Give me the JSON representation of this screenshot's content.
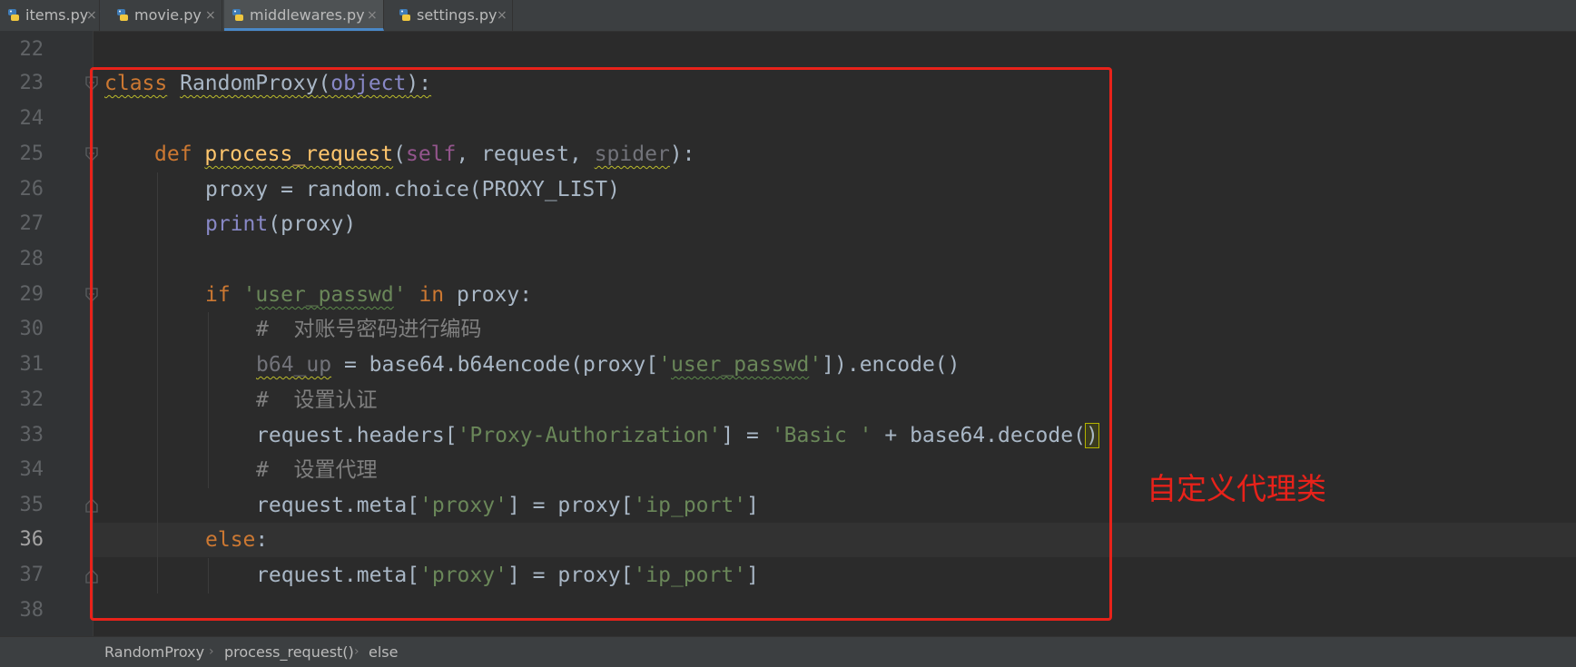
{
  "tabs": [
    {
      "label": "items.py",
      "close": "×",
      "icon": "python-file-icon"
    },
    {
      "label": "movie.py",
      "close": "×",
      "icon": "python-file-icon"
    },
    {
      "label": "middlewares.py",
      "close": "×",
      "icon": "python-file-icon",
      "active": true
    },
    {
      "label": "settings.py",
      "close": "×",
      "icon": "python-file-icon"
    }
  ],
  "editor": {
    "line_numbers": [
      "22",
      "23",
      "24",
      "25",
      "26",
      "27",
      "28",
      "29",
      "30",
      "31",
      "32",
      "33",
      "34",
      "35",
      "36",
      "37",
      "38"
    ],
    "current_line": "36",
    "code": {
      "l23_class": "class",
      "l23_name": "RandomProxy",
      "l23_p1": "(",
      "l23_object": "object",
      "l23_p2": "):",
      "l25_def": "def",
      "l25_fn": "process_request",
      "l25_p1": "(",
      "l25_self": "self",
      "l25_rest": ", request, ",
      "l25_spider": "spider",
      "l25_p2": "):",
      "l26": "proxy = random.choice(PROXY_LIST)",
      "l27_print": "print",
      "l27_rest": "(proxy)",
      "l29_if": "if",
      "l29_sp": " ",
      "l29_q1": "'",
      "l29_str": "user_passwd",
      "l29_q2": "'",
      "l29_in": " in",
      "l29_rest": " proxy:",
      "l30": "#  对账号密码进行编码",
      "l31_var": "b64_up",
      "l31_mid": " = base64.b64encode(proxy[",
      "l31_q1": "'",
      "l31_str": "user_passwd",
      "l31_q2": "'",
      "l31_end": "]).encode()",
      "l32": "#  设置认证",
      "l33_a": "request.headers[",
      "l33_str1": "'Proxy-Authorization'",
      "l33_b": "] = ",
      "l33_str2": "'Basic '",
      "l33_c": " + base64.decode(",
      "l33_d": ")",
      "l34": "#  设置代理",
      "l35_a": "request.meta[",
      "l35_s1": "'proxy'",
      "l35_b": "] = proxy[",
      "l35_s2": "'ip_port'",
      "l35_c": "]",
      "l36_else": "else",
      "l36_colon": ":",
      "l37_a": "request.meta[",
      "l37_s1": "'proxy'",
      "l37_b": "] = proxy[",
      "l37_s2": "'ip_port'",
      "l37_c": "]"
    }
  },
  "annotation": "自定义代理类",
  "breadcrumb": [
    "RandomProxy",
    "process_request()",
    "else"
  ],
  "breadcrumb_sep": "›",
  "colors": {
    "background": "#2b2b2b",
    "keyword": "#cc7832",
    "string": "#6a8759",
    "comment": "#808080",
    "function": "#ffc66d",
    "annotation_red": "#e8221a",
    "tab_accent": "#4a88c7"
  }
}
